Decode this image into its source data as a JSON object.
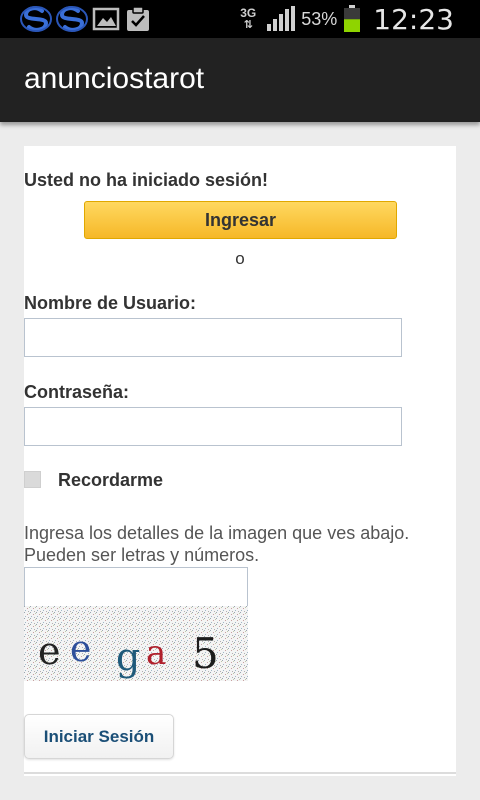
{
  "status_bar": {
    "network_type": "3G",
    "battery_percent": "53%",
    "battery_level": 0.53,
    "clock": "12:23",
    "notification_icons": [
      "sync-icon",
      "sync-icon",
      "image-icon",
      "clipboard-check-icon"
    ]
  },
  "app": {
    "title": "anunciostarot"
  },
  "login": {
    "not_logged_in": "Usted no ha iniciado sesión!",
    "ingresar_button": "Ingresar",
    "or_text": "o",
    "username_label": "Nombre de Usuario:",
    "username_value": "",
    "password_label": "Contraseña:",
    "password_value": "",
    "remember_label": "Recordarme",
    "remember_checked": false,
    "captcha_instructions": "Ingresa los detalles de la imagen que ves abajo. Pueden ser letras y números.",
    "captcha_value": "",
    "captcha_text": "eega5",
    "submit_button": "Iniciar Sesión"
  },
  "colors": {
    "accent_button": "#f6b828",
    "action_bar": "#222222",
    "link_blue": "#1b4f77"
  }
}
